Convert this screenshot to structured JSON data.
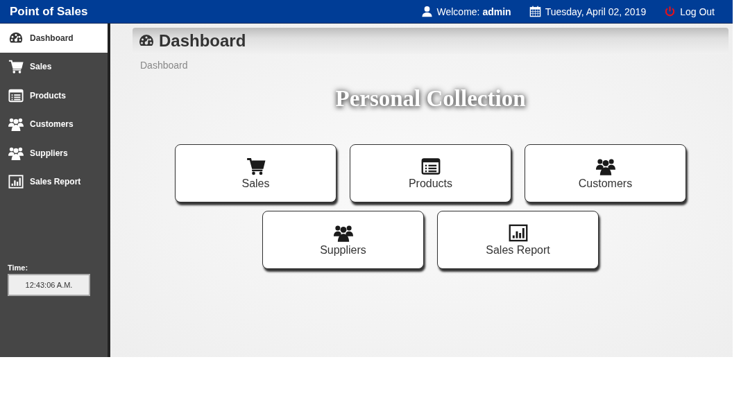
{
  "app": {
    "title": "Point of Sales"
  },
  "header": {
    "welcome_label": "Welcome:",
    "user": "admin",
    "date": "Tuesday, April 02, 2019",
    "logout": "Log Out"
  },
  "sidebar": {
    "items": [
      {
        "label": "Dashboard",
        "selected": true
      },
      {
        "label": "Sales",
        "selected": false
      },
      {
        "label": "Products",
        "selected": false
      },
      {
        "label": "Customers",
        "selected": false
      },
      {
        "label": "Suppliers",
        "selected": false
      },
      {
        "label": "Sales Report",
        "selected": false
      }
    ],
    "time_label": "Time:",
    "time": "12:43:06 A.M."
  },
  "page": {
    "title": "Dashboard",
    "breadcrumb": "Dashboard",
    "banner": "Personal Collection",
    "tiles": [
      {
        "label": "Sales"
      },
      {
        "label": "Products"
      },
      {
        "label": "Customers"
      },
      {
        "label": "Suppliers"
      },
      {
        "label": "Sales Report"
      }
    ]
  }
}
